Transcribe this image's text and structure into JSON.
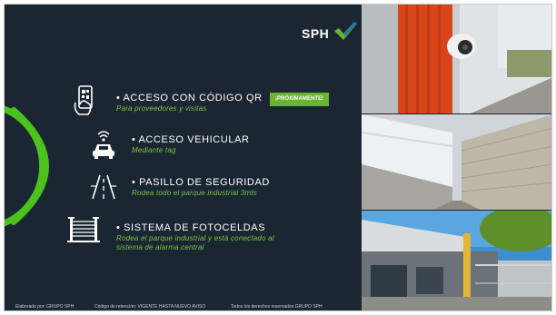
{
  "logo": {
    "text": "SPH",
    "check_color": "#6ab42f",
    "accent_color": "#1e6fb0"
  },
  "features": [
    {
      "title": "• ACCESO CON CÓDIGO QR",
      "subtitle": "Para proveedores y visitas",
      "icon": "qr-phone-icon"
    },
    {
      "title": "•  ACCESO VEHICULAR",
      "subtitle": "Mediante tag",
      "icon": "car-wireless-icon"
    },
    {
      "title": "•  PASILLO DE SEGURIDAD",
      "subtitle": "Rodea todo el parque industrial 3mts",
      "icon": "corridor-icon"
    },
    {
      "title": "•  SISTEMA DE FOTOCELDAS",
      "subtitle_line1": "Rodea el parque industrial y está conectado al",
      "subtitle_line2": "sistema de alarma central",
      "icon": "fence-icon"
    }
  ],
  "badge": "¡PRÓXIMAMENTE!",
  "footer": {
    "made_by": "Elaborado por: GRUPO SPH",
    "retention": "Código de retención: VIGENTE  HASTA NUEVO AVISO",
    "rights": "Todos los derechos reservados GRUPO SPH"
  },
  "colors": {
    "background": "#1b2633",
    "accent_green": "#6ab42f",
    "text": "#ffffff",
    "subtitle_green": "#7cc242"
  }
}
